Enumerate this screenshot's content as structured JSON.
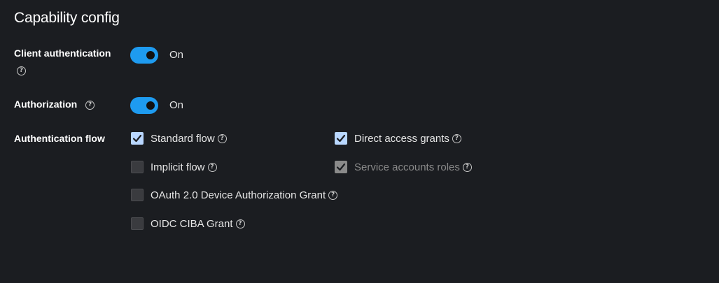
{
  "section": {
    "title": "Capability config"
  },
  "client_auth": {
    "label": "Client authentication",
    "state_text": "On"
  },
  "authorization": {
    "label": "Authorization",
    "state_text": "On"
  },
  "auth_flow": {
    "label": "Authentication flow",
    "options": {
      "standard_flow": {
        "label": "Standard flow",
        "checked": true
      },
      "direct_access_grants": {
        "label": "Direct access grants",
        "checked": true
      },
      "implicit_flow": {
        "label": "Implicit flow",
        "checked": false
      },
      "service_accounts_roles": {
        "label": "Service accounts roles",
        "checked": true,
        "disabled": true
      },
      "oauth_device_grant": {
        "label": "OAuth 2.0 Device Authorization Grant",
        "checked": false
      },
      "oidc_ciba_grant": {
        "label": "OIDC CIBA Grant",
        "checked": false
      }
    }
  },
  "icons": {
    "help": "question-circle-icon",
    "check": "checkmark-icon"
  },
  "help_glyph": "?",
  "colors": {
    "background": "#1b1d21",
    "switch_on": "#1e9bf0",
    "checkbox_checked": "#b9d7ff",
    "checkbox_disabled": "#8a8a8a"
  }
}
